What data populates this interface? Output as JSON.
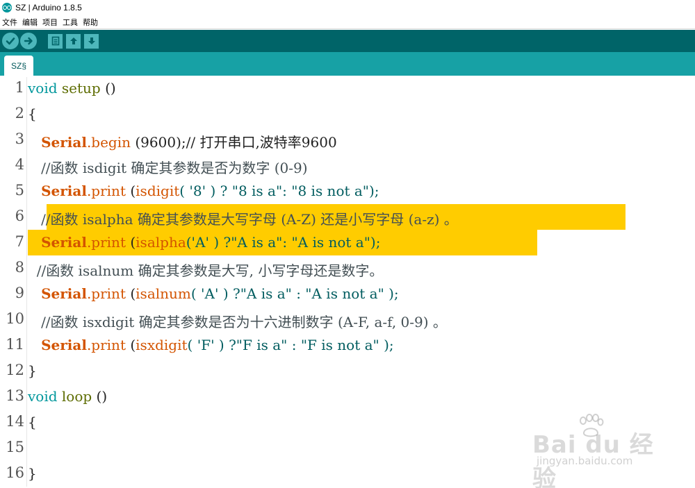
{
  "window": {
    "title": "SZ | Arduino 1.8.5"
  },
  "menubar": {
    "items": [
      "文件",
      "编辑",
      "项目",
      "工具",
      "帮助"
    ]
  },
  "toolbar": {
    "buttons": [
      {
        "icon": "check-icon"
      },
      {
        "icon": "arrow-right-icon"
      },
      {
        "icon": "new-file-icon"
      },
      {
        "icon": "arrow-up-icon"
      },
      {
        "icon": "arrow-down-icon"
      }
    ]
  },
  "tabs": [
    {
      "label": "SZ§"
    }
  ],
  "editor": {
    "highlight_color": "#ffcc00",
    "lines": [
      {
        "num": "1",
        "tokens": [
          {
            "t": "void",
            "c": "kw-type"
          },
          {
            "t": " "
          },
          {
            "t": "setup",
            "c": "kw-func"
          },
          {
            "t": " ()"
          }
        ]
      },
      {
        "num": "2",
        "tokens": [
          {
            "t": "{"
          }
        ]
      },
      {
        "num": "3",
        "tokens": [
          {
            "t": "   "
          },
          {
            "t": "Serial",
            "c": "kw-serial"
          },
          {
            "t": ".",
            "c": "kw-method"
          },
          {
            "t": "begin",
            "c": "kw-method"
          },
          {
            "t": " (9600);// 打开串口,波特率9600"
          }
        ]
      },
      {
        "num": "4",
        "tokens": [
          {
            "t": "   //函数 isdigit 确定其参数是否为数字 (0-9)",
            "c": "comment"
          }
        ]
      },
      {
        "num": "5",
        "tokens": [
          {
            "t": "   "
          },
          {
            "t": "Serial",
            "c": "kw-serial"
          },
          {
            "t": ".",
            "c": "kw-method"
          },
          {
            "t": "print",
            "c": "kw-method"
          },
          {
            "t": " ("
          },
          {
            "t": "isdigit",
            "c": "kw-method"
          },
          {
            "t": "( '8' ) ? \"8 is a\": \"8 is not a\");",
            "c": "str"
          }
        ]
      },
      {
        "num": "6",
        "hl": [
          67,
          900
        ],
        "tokens": [
          {
            "t": "   //函数 isalpha 确定其参数是大写字母 (A-Z) 还是小写字母 (a-z) 。",
            "c": "comment"
          }
        ]
      },
      {
        "num": "7",
        "hl": [
          40,
          773
        ],
        "tokens": [
          {
            "t": "   "
          },
          {
            "t": "Serial",
            "c": "kw-serial"
          },
          {
            "t": ".",
            "c": "kw-method"
          },
          {
            "t": "print",
            "c": "kw-method"
          },
          {
            "t": " ("
          },
          {
            "t": "isalpha",
            "c": "kw-method"
          },
          {
            "t": "('A' ) ?\"A is a\": \"A is not a\");",
            "c": "str"
          }
        ]
      },
      {
        "num": "8",
        "tokens": [
          {
            "t": "  //函数 isalnum 确定其参数是大写, 小写字母还是数字。",
            "c": "comment"
          }
        ]
      },
      {
        "num": "9",
        "tokens": [
          {
            "t": "   "
          },
          {
            "t": "Serial",
            "c": "kw-serial"
          },
          {
            "t": ".",
            "c": "kw-method"
          },
          {
            "t": "print",
            "c": "kw-method"
          },
          {
            "t": " ("
          },
          {
            "t": "isalnum",
            "c": "kw-method"
          },
          {
            "t": "( 'A' ) ?\"A is a\" : \"A is not a\" );",
            "c": "str"
          }
        ]
      },
      {
        "num": "10",
        "tokens": [
          {
            "t": "   //函数 isxdigit 确定其参数是否为十六进制数字 (A-F, a-f, 0-9) 。",
            "c": "comment"
          }
        ]
      },
      {
        "num": "11",
        "tokens": [
          {
            "t": "   "
          },
          {
            "t": "Serial",
            "c": "kw-serial"
          },
          {
            "t": ".",
            "c": "kw-method"
          },
          {
            "t": "print",
            "c": "kw-method"
          },
          {
            "t": " ("
          },
          {
            "t": "isxdigit",
            "c": "kw-method"
          },
          {
            "t": "( 'F' ) ?\"F is a\" : \"F is not a\" );",
            "c": "str"
          }
        ]
      },
      {
        "num": "12",
        "tokens": [
          {
            "t": "}"
          }
        ]
      },
      {
        "num": "13",
        "tokens": [
          {
            "t": "void",
            "c": "kw-type"
          },
          {
            "t": " "
          },
          {
            "t": "loop",
            "c": "kw-func"
          },
          {
            "t": " ()"
          }
        ]
      },
      {
        "num": "14",
        "tokens": [
          {
            "t": "{"
          }
        ]
      },
      {
        "num": "15",
        "tokens": []
      },
      {
        "num": "16",
        "tokens": [
          {
            "t": "}"
          }
        ]
      }
    ]
  },
  "watermark": {
    "brand": "Bai du 经验",
    "url": "jingyan.baidu.com"
  }
}
